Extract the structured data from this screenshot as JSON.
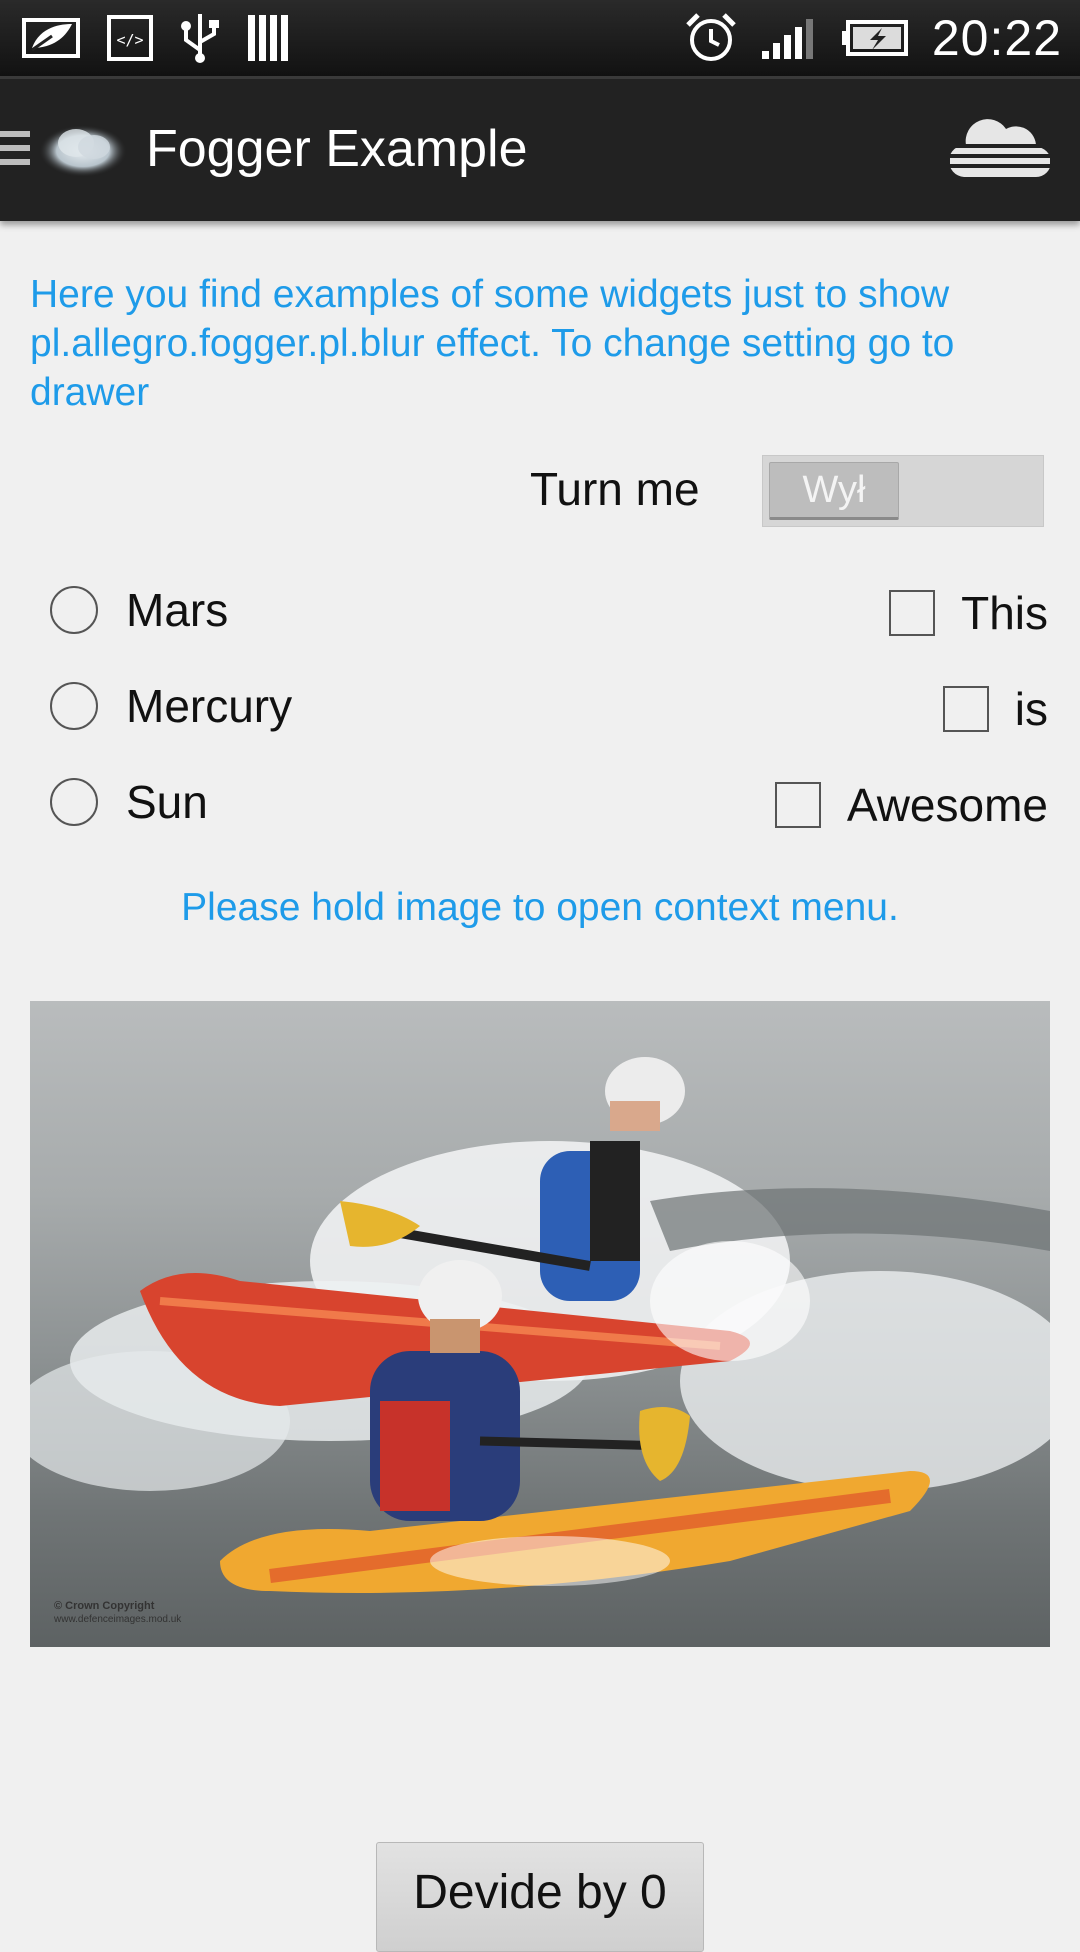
{
  "status_bar": {
    "time": "20:22",
    "icons": [
      "leaf-notification-icon",
      "code-icon",
      "usb-icon",
      "barcode-icon",
      "alarm-icon",
      "signal-icon",
      "battery-charging-icon"
    ]
  },
  "action_bar": {
    "title": "Fogger Example",
    "left_icons": [
      "drawer-menu-icon",
      "app-logo-cloud-icon"
    ],
    "right_icon": "cloud-icon"
  },
  "content": {
    "intro": "Here you find examples of some widgets just to show pl.allegro.fogger.pl.blur effect. To change setting go to drawer",
    "switch": {
      "label": "Turn me",
      "state_text": "Wył",
      "on": false
    },
    "radios": [
      {
        "label": "Mars",
        "checked": false
      },
      {
        "label": "Mercury",
        "checked": false
      },
      {
        "label": "Sun",
        "checked": false
      }
    ],
    "checkboxes": [
      {
        "label": "This",
        "checked": false
      },
      {
        "label": "is",
        "checked": false
      },
      {
        "label": "Awesome",
        "checked": false
      }
    ],
    "hint": "Please hold image to open context menu.",
    "image": {
      "description_icon": "kayakers-photo",
      "watermark_line1": "© Crown Copyright",
      "watermark_line2": "www.defenceimages.mod.uk"
    },
    "button_label": "Devide by 0"
  },
  "colors": {
    "accent_text": "#1e9be9",
    "action_bar": "#222222",
    "background": "#f0f0f0"
  }
}
